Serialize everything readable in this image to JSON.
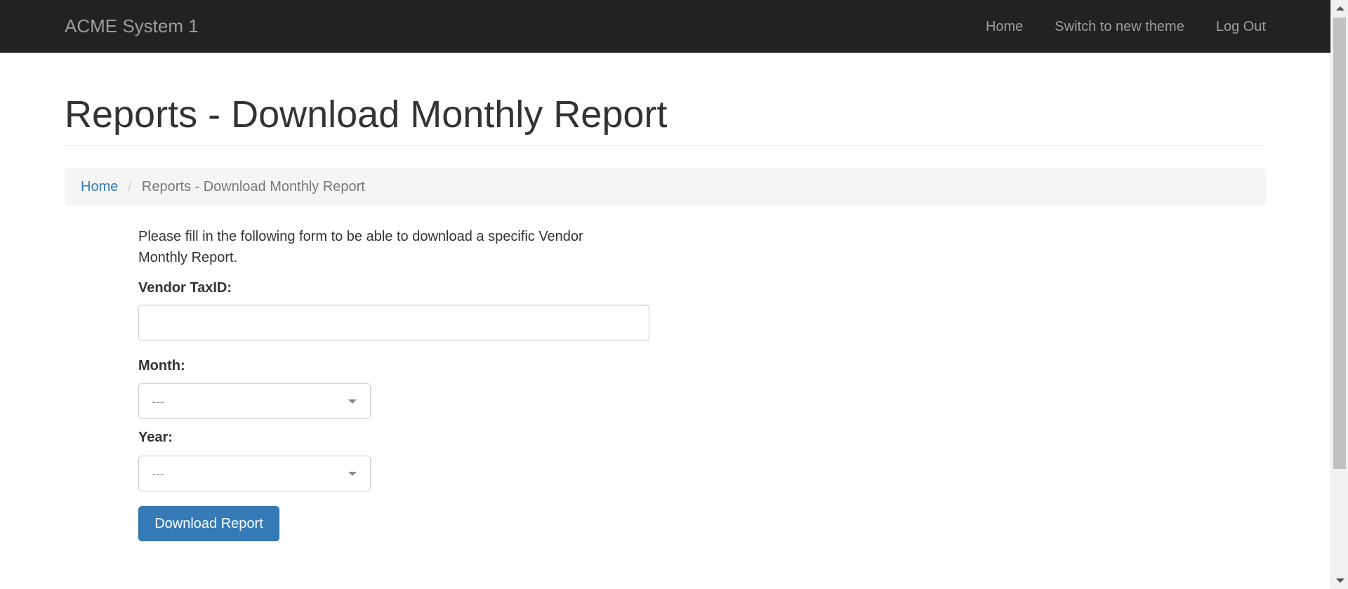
{
  "navbar": {
    "brand": "ACME System 1",
    "links": [
      "Home",
      "Switch to new theme",
      "Log Out"
    ]
  },
  "page": {
    "title": "Reports - Download Monthly Report"
  },
  "breadcrumb": {
    "home": "Home",
    "separator": "/",
    "current": "Reports - Download Monthly Report"
  },
  "form": {
    "intro": "Please fill in the following form to be able to download a specific Vendor Monthly Report.",
    "taxid_label": "Vendor TaxID:",
    "taxid_value": "",
    "month_label": "Month:",
    "month_value": "---",
    "year_label": "Year:",
    "year_value": "---",
    "submit_label": "Download Report"
  },
  "colors": {
    "navbar_bg": "#222222",
    "link": "#337ab7",
    "button_bg": "#337ab7",
    "breadcrumb_bg": "#f5f5f5"
  }
}
